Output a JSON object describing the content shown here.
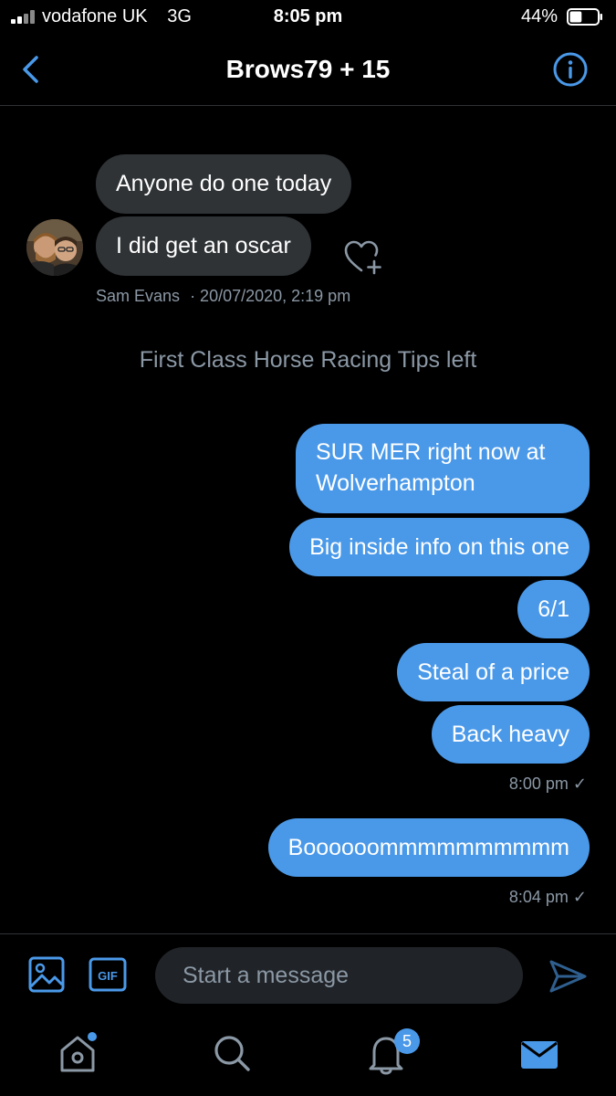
{
  "status_bar": {
    "carrier": "vodafone UK",
    "network": "3G",
    "time": "8:05 pm",
    "battery": "44%",
    "battery_level": 0.44
  },
  "header": {
    "title": "Brows79 + 15"
  },
  "incoming": {
    "messages": [
      "Anyone do one today",
      "I did get an oscar"
    ],
    "sender": "Sam Evans",
    "timestamp": "· 20/07/2020, 2:19 pm"
  },
  "event": "First Class Horse Racing Tips left",
  "outgoing_group_1": {
    "messages": [
      [
        "SUR MER right now at",
        "Wolverhampton"
      ],
      "Big inside info on this one",
      "6/1",
      "Steal of a price",
      "Back heavy"
    ],
    "timestamp": "8:00 pm ✓"
  },
  "outgoing_group_2": {
    "messages": [
      "Boooooommmmmmmmmm"
    ],
    "timestamp": "8:04 pm ✓"
  },
  "composer": {
    "placeholder": "Start a message"
  },
  "tabbar": {
    "notifications_count": "5"
  },
  "colors": {
    "accent": "#4a99e9",
    "background": "#000000",
    "incoming_bubble": "#2f3336",
    "muted_text": "#8b98a5"
  },
  "icons": [
    "back-icon",
    "info-icon",
    "heart-plus-icon",
    "image-icon",
    "gif-icon",
    "send-icon",
    "home-icon",
    "search-icon",
    "bell-icon",
    "mail-icon"
  ]
}
